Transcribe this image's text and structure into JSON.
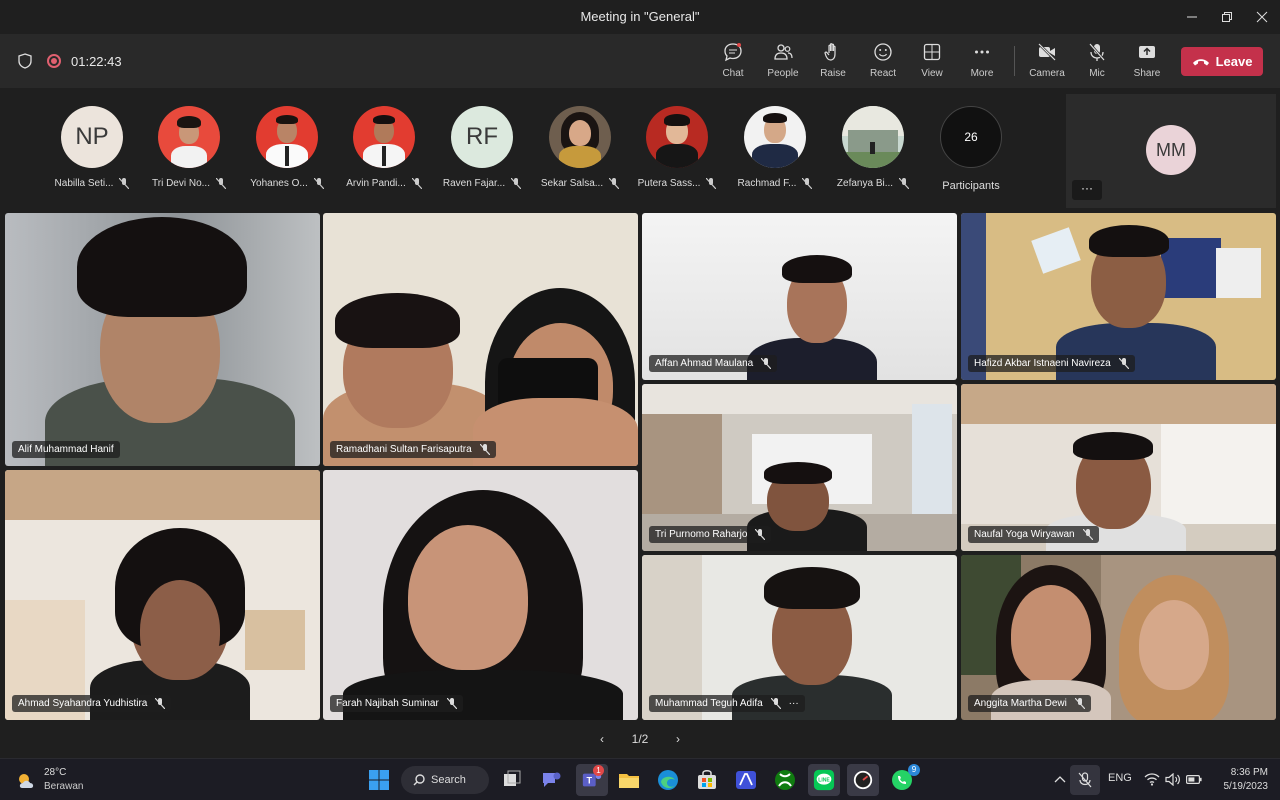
{
  "window": {
    "title": "Meeting in \"General\""
  },
  "toolbar": {
    "timer": "01:22:43",
    "buttons": {
      "chat": "Chat",
      "people": "People",
      "raise": "Raise",
      "react": "React",
      "view": "View",
      "more": "More",
      "camera": "Camera",
      "mic": "Mic",
      "share": "Share"
    },
    "leave": "Leave"
  },
  "strip": {
    "participants": [
      {
        "name": "Nabilla Seti...",
        "initials": "NP"
      },
      {
        "name": "Tri Devi No..."
      },
      {
        "name": "Yohanes O..."
      },
      {
        "name": "Arvin Pandi..."
      },
      {
        "name": "Raven Fajar...",
        "initials": "RF"
      },
      {
        "name": "Sekar Salsa..."
      },
      {
        "name": "Putera Sass..."
      },
      {
        "name": "Rachmad F..."
      },
      {
        "name": "Zefanya Bi..."
      }
    ],
    "count": "26",
    "count_label": "Participants",
    "self_initials": "MM"
  },
  "tiles": [
    {
      "name": "Alif Muhammad Hanif"
    },
    {
      "name": "Ramadhani Sultan Farisaputra"
    },
    {
      "name": "Affan Ahmad Maulana"
    },
    {
      "name": "Hafizd Akbar Istnaeni Navireza"
    },
    {
      "name": "Tri Purnomo Raharjo"
    },
    {
      "name": "Naufal Yoga Wiryawan"
    },
    {
      "name": "Ahmad Syahandra Yudhistira"
    },
    {
      "name": "Farah Najibah Suminar"
    },
    {
      "name": "Muhammad Teguh Adifa"
    },
    {
      "name": "Anggita Martha Dewi"
    }
  ],
  "pager": {
    "label": "1/2"
  },
  "taskbar": {
    "weather_temp": "28°C",
    "weather_desc": "Berawan",
    "search": "Search",
    "teams_badge": "1",
    "whatsapp_badge": "9",
    "lang": "ENG",
    "time": "8:36 PM",
    "date": "5/19/2023"
  }
}
